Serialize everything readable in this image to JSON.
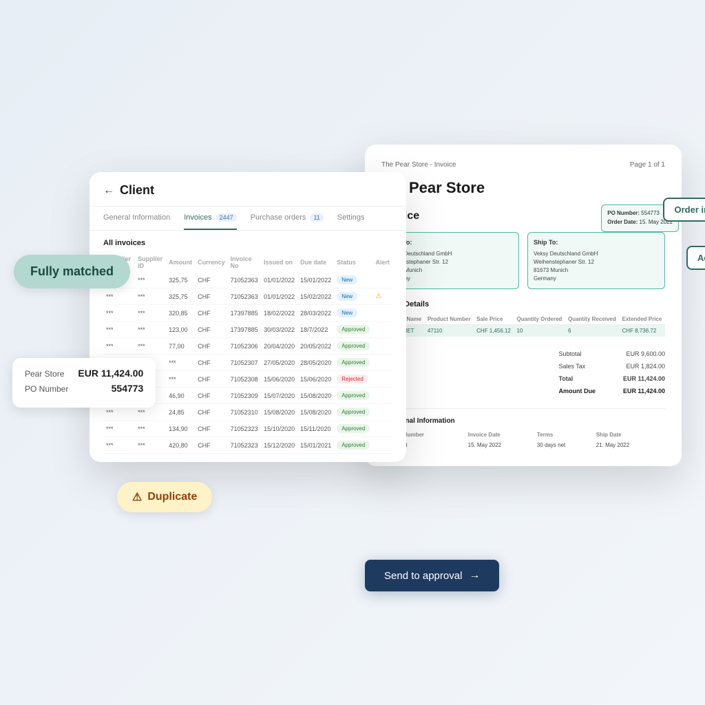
{
  "scene": {
    "background_color": "#f0f4f8"
  },
  "invoice_panel": {
    "top_bar_left": "The Pear Store - Invoice",
    "top_bar_right": "Page 1 of 1",
    "company_name": "Pear Store",
    "invoice_label": "Invoice",
    "po_block": {
      "po_number_label": "PO Number:",
      "po_number_value": "554773",
      "order_date_label": "Order Date:",
      "order_date_value": "15. May 2022"
    },
    "order_info_badge": "Order information",
    "address_badge": "Address",
    "sold_to_label": "Sold To:",
    "sold_to_address": "Veksy Deutschland GmbH\nWeihenstephaner Str. 12\n81673 Munich\nGermany",
    "ship_to_label": "Ship To:",
    "ship_to_address": "Veksy Deutschland GmbH\nWeihenstephaner Str. 12\n81673 Munich\nGermany",
    "order_details_title": "Order Details",
    "order_table_headers": [
      "Product Name",
      "Product Number",
      "Sale Price",
      "Quantity Ordered",
      "Quantity Received",
      "Extended Price"
    ],
    "order_table_rows": [
      {
        "name": "CABERNET",
        "number": "47110",
        "price": "CHF 1,456.12",
        "qty_ord": "10",
        "qty_rec": "6",
        "extended": "CHF 8,736.72"
      }
    ],
    "totals": {
      "subtotal_label": "Subtotal",
      "subtotal_value": "EUR 9,600.00",
      "sales_tax_label": "Sales Tax",
      "sales_tax_value": "EUR 1,824.00",
      "total_label": "Total",
      "total_value": "EUR 11,424.00",
      "amount_due_label": "Amount Due",
      "amount_due_value": "EUR 11,424.00"
    },
    "additional_info_title": "Additional Information",
    "add_info_headers": [
      "Invoice Number",
      "Invoice Date",
      "Terms",
      "Ship Date"
    ],
    "add_info_row": [
      "INV35678",
      "15. May 2022",
      "30 days net",
      "21. May 2022"
    ]
  },
  "client_panel": {
    "back_label": "Client",
    "tabs": [
      {
        "label": "General Information",
        "active": false
      },
      {
        "label": "Invoices",
        "active": true,
        "badge": "2447"
      },
      {
        "label": "Purchase orders",
        "active": false,
        "badge": "11"
      },
      {
        "label": "Settings",
        "active": false
      }
    ],
    "all_invoices_label": "All invoices",
    "table_headers": [
      "Supplier name",
      "Supplier ID",
      "Amount",
      "Currency",
      "Invoice No",
      "Issued on",
      "Due date",
      "Status",
      "Alert"
    ],
    "rows": [
      {
        "supplier": "***",
        "id": "***",
        "amount": "325,75",
        "currency": "CHF",
        "invoice_no": "71052363",
        "issued": "01/01/2022",
        "due": "15/01/2022",
        "status": "New",
        "alert": ""
      },
      {
        "supplier": "***",
        "id": "***",
        "amount": "325,75",
        "currency": "CHF",
        "invoice_no": "71052363",
        "issued": "01/01/2022",
        "due": "15/02/2022",
        "status": "New",
        "alert": "⚠"
      },
      {
        "supplier": "***",
        "id": "***",
        "amount": "320,85",
        "currency": "CHF",
        "invoice_no": "17397885",
        "issued": "18/02/2022",
        "due": "28/03/2022",
        "status": "New",
        "alert": ""
      },
      {
        "supplier": "***",
        "id": "***",
        "amount": "123,00",
        "currency": "CHF",
        "invoice_no": "17397885",
        "issued": "30/03/2022",
        "due": "18/7/2022",
        "status": "Approved",
        "alert": ""
      },
      {
        "supplier": "***",
        "id": "***",
        "amount": "77,00",
        "currency": "CHF",
        "invoice_no": "71052306",
        "issued": "20/04/2020",
        "due": "20/05/2022",
        "status": "Approved",
        "alert": ""
      },
      {
        "supplier": "***",
        "id": "***",
        "amount": "***",
        "currency": "CHF",
        "invoice_no": "71052307",
        "issued": "27/05/2020",
        "due": "28/05/2020",
        "status": "Approved",
        "alert": ""
      },
      {
        "supplier": "***",
        "id": "***",
        "amount": "***",
        "currency": "CHF",
        "invoice_no": "71052308",
        "issued": "15/06/2020",
        "due": "15/06/2020",
        "status": "Rejected",
        "alert": ""
      },
      {
        "supplier": "***",
        "id": "***",
        "amount": "46,90",
        "currency": "CHF",
        "invoice_no": "71052309",
        "issued": "15/07/2020",
        "due": "15/08/2020",
        "status": "Approved",
        "alert": ""
      },
      {
        "supplier": "***",
        "id": "***",
        "amount": "24,85",
        "currency": "CHF",
        "invoice_no": "71052310",
        "issued": "15/08/2020",
        "due": "15/08/2020",
        "status": "Approved",
        "alert": ""
      },
      {
        "supplier": "***",
        "id": "***",
        "amount": "134,90",
        "currency": "CHF",
        "invoice_no": "71052323",
        "issued": "15/10/2020",
        "due": "15/11/2020",
        "status": "Approved",
        "alert": ""
      },
      {
        "supplier": "***",
        "id": "***",
        "amount": "420,80",
        "currency": "CHF",
        "invoice_no": "71052323",
        "issued": "15/12/2020",
        "due": "15/01/2021",
        "status": "Approved",
        "alert": ""
      }
    ]
  },
  "fully_matched_badge": "Fully matched",
  "duplicate_badge": {
    "icon": "⚠",
    "label": "Duplicate"
  },
  "info_card": {
    "supplier_label": "Pear Store",
    "amount_label": "EUR 11,424.00",
    "po_label": "PO Number",
    "po_value": "554773"
  },
  "send_approval_btn": {
    "label": "Send to approval",
    "arrow": "→"
  }
}
